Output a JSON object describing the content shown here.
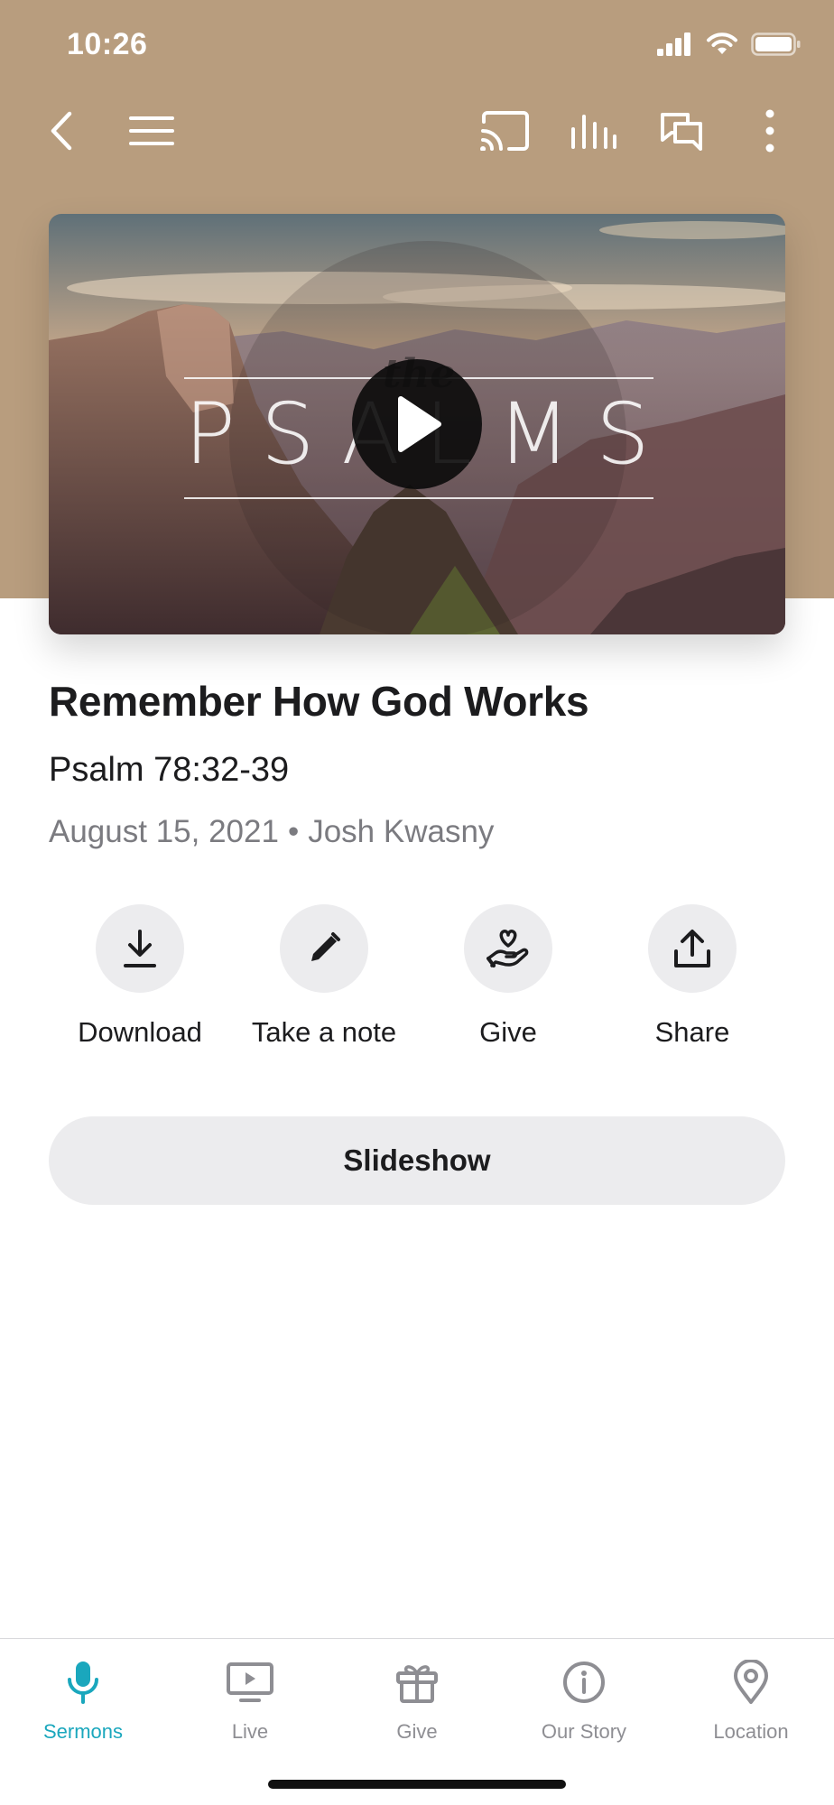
{
  "status_bar": {
    "time": "10:26"
  },
  "toolbar": {
    "icons": [
      "back-chevron-icon",
      "hamburger-menu-icon",
      "cast-icon",
      "audio-bars-icon",
      "chat-icon",
      "more-vertical-icon"
    ]
  },
  "hero": {
    "title_word": "PSALMS",
    "title_prefix": "the"
  },
  "sermon": {
    "title": "Remember How God Works",
    "scripture": "Psalm 78:32-39",
    "date": "August 15, 2021",
    "separator": "•",
    "speaker": "Josh Kwasny"
  },
  "actions": [
    {
      "label": "Download",
      "icon": "download-icon"
    },
    {
      "label": "Take a note",
      "icon": "pencil-icon"
    },
    {
      "label": "Give",
      "icon": "heart-hand-icon"
    },
    {
      "label": "Share",
      "icon": "share-icon"
    }
  ],
  "slideshow": {
    "label": "Slideshow"
  },
  "tabs": [
    {
      "label": "Sermons",
      "icon": "microphone-icon",
      "active": true
    },
    {
      "label": "Live",
      "icon": "tv-play-icon",
      "active": false
    },
    {
      "label": "Give",
      "icon": "gift-icon",
      "active": false
    },
    {
      "label": "Our Story",
      "icon": "info-icon",
      "active": false
    },
    {
      "label": "Location",
      "icon": "location-pin-icon",
      "active": false
    }
  ],
  "colors": {
    "header_bg": "#b89d7e",
    "accent": "#1aa7bd",
    "button_bg": "#ececee",
    "secondary_text": "#7b7b80"
  }
}
